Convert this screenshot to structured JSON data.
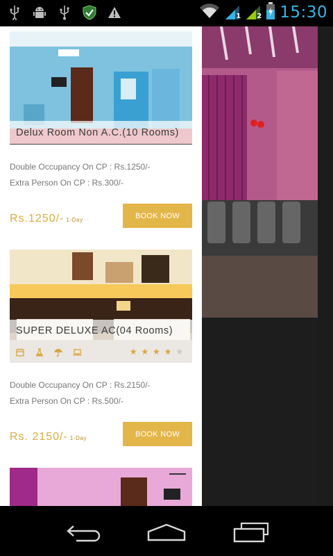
{
  "status_bar": {
    "time": "15:30",
    "icons": [
      "usb-icon",
      "android-debug-icon",
      "usb-icon",
      "shield-check-icon",
      "warning-icon",
      "wifi-icon",
      "signal-1-icon",
      "signal-2-icon",
      "battery-charging-icon"
    ],
    "signal_labels": [
      "1",
      "2"
    ]
  },
  "rooms": [
    {
      "title": "Delux Room Non A.C.(10 Rooms)",
      "desc_lines": [
        "Double Occupancy On CP : Rs.1250/-",
        "Extra Person On CP : Rs.300/-"
      ],
      "price": "Rs.1250/-",
      "price_unit": "1-Day",
      "book_label": "BOOK NOW"
    },
    {
      "title": "SUPER DELUXE AC(04 Rooms)",
      "amenities": [
        "calendar-icon",
        "flask-icon",
        "umbrella-icon",
        "laptop-icon"
      ],
      "rating": 4,
      "rating_max": 5,
      "desc_lines": [
        "Double Occupancy On CP : Rs.2150/-",
        "Extra Person On CP : Rs.500/-"
      ],
      "price": "Rs. 2150/-",
      "price_unit": "1-Day",
      "book_label": "BOOK NOW"
    }
  ],
  "colors": {
    "accent": "#e3b64a",
    "price": "#d9ad3c",
    "clock": "#33b5e5"
  },
  "nav": [
    "back-icon",
    "home-icon",
    "recent-apps-icon"
  ]
}
